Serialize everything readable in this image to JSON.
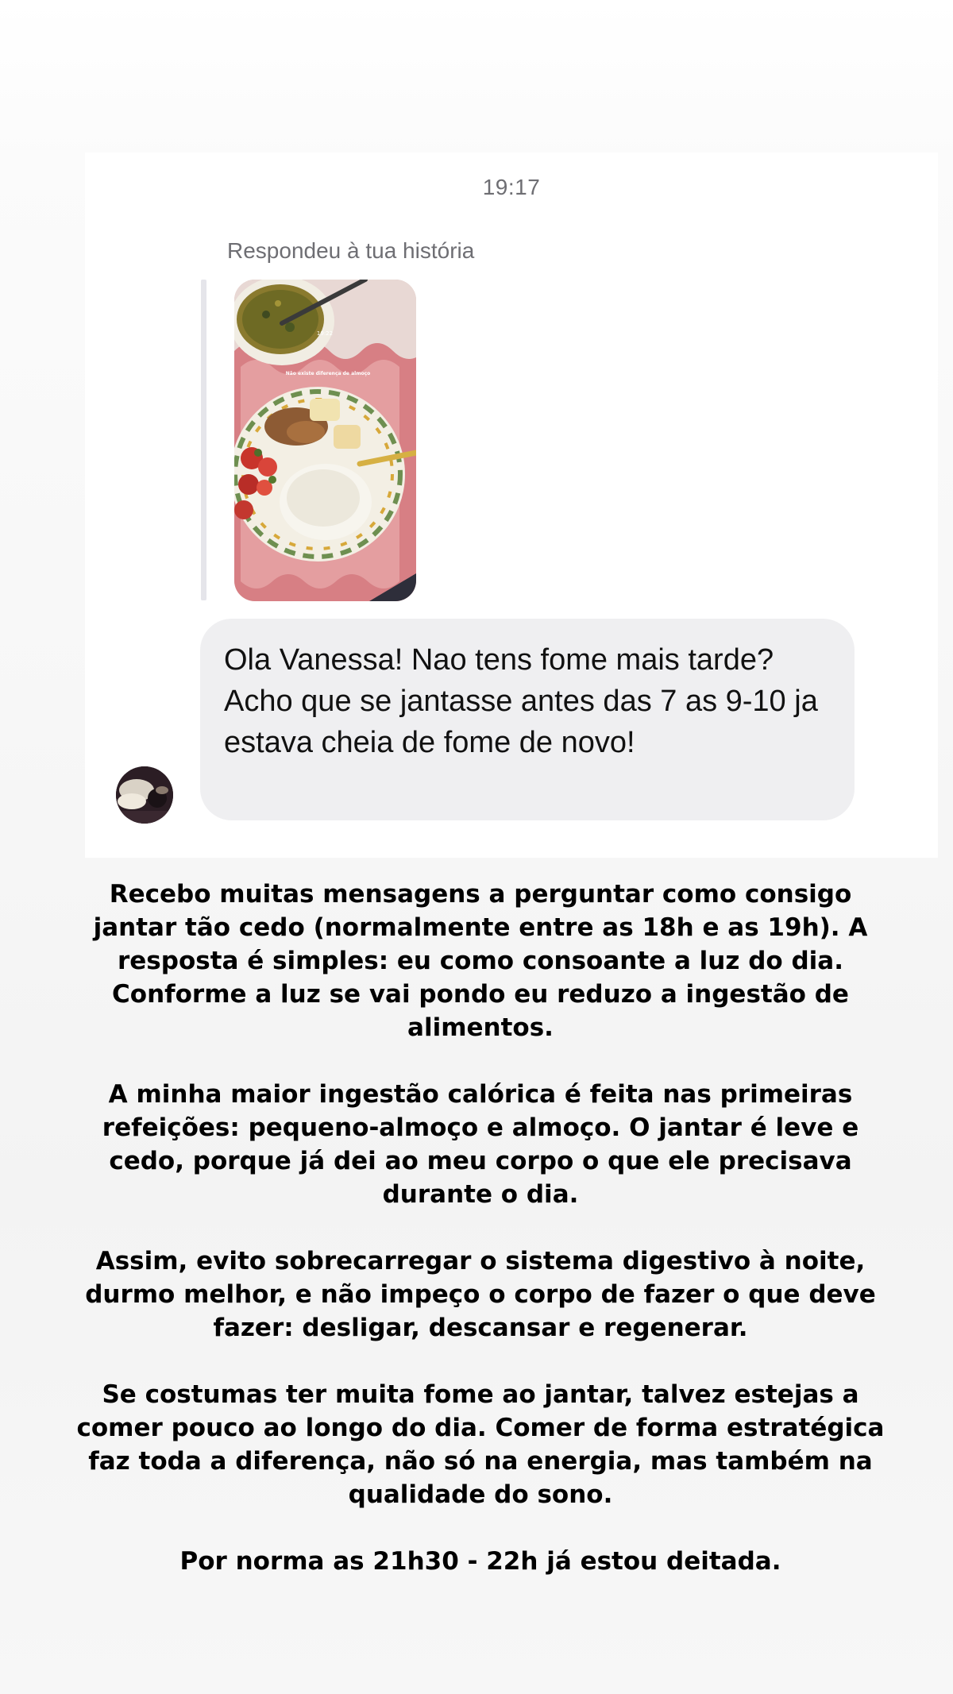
{
  "dm": {
    "timestamp": "19:17",
    "reply_label": "Respondeu à tua história",
    "story_overlay_time": "19:22",
    "story_overlay_text": "Não existe diferença de almoço",
    "message_text": "Ola Vanessa! Nao tens fome mais tarde? Acho que se jantasse antes das 7 as 9-10 ja estava cheia de fome de novo!"
  },
  "caption": {
    "paragraphs": [
      "Recebo muitas mensagens a perguntar como consigo jantar tão cedo (normalmente entre as 18h e as 19h). A resposta é simples: eu como consoante a luz do dia. Conforme a luz se vai pondo eu reduzo a ingestão de alimentos.",
      "A minha maior ingestão calórica é feita nas primeiras refeições: pequeno-almoço e almoço. O jantar é leve e cedo, porque já dei ao meu corpo o que ele precisava durante o dia.",
      "Assim, evito sobrecarregar o sistema digestivo à noite, durmo melhor, e não impeço o corpo de fazer o que deve fazer: desligar, descansar e regenerar.",
      "Se costumas ter muita fome ao jantar, talvez estejas a comer pouco ao longo do dia. Comer de forma estratégica faz toda a diferença, não só na energia, mas também na qualidade do sono.",
      "Por norma as 21h30 - 22h já estou deitada."
    ]
  },
  "colors": {
    "bubble_bg": "#efeff1",
    "meta_text": "#6e6e73",
    "placemat": "#d27c7f"
  }
}
